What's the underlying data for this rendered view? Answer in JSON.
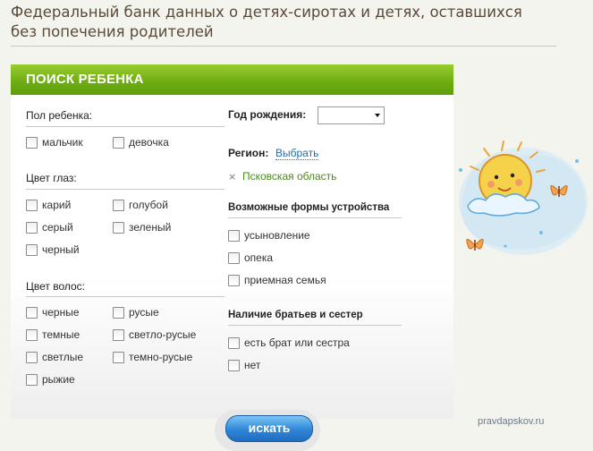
{
  "header": {
    "title": "Федеральный банк данных о детях-сиротах и детях, оставшихся без попечения родителей"
  },
  "card": {
    "title": "ПОИСК РЕБЕНКА",
    "gender": {
      "label": "Пол ребенка:",
      "options": [
        "мальчик",
        "девочка"
      ]
    },
    "eye_color": {
      "label": "Цвет глаз:",
      "options": [
        "карий",
        "голубой",
        "серый",
        "зеленый",
        "черный"
      ]
    },
    "hair_color": {
      "label": "Цвет волос:",
      "options": [
        "черные",
        "русые",
        "темные",
        "светло-русые",
        "светлые",
        "темно-русые",
        "рыжие"
      ]
    },
    "birth_year": {
      "label": "Год рождения:",
      "selected": ""
    },
    "region": {
      "label": "Регион:",
      "link": "Выбрать",
      "selected": "Псковская область",
      "remove_glyph": "×"
    },
    "placement": {
      "label": "Возможные формы устройства",
      "options": [
        "усыновление",
        "опека",
        "приемная семья"
      ]
    },
    "siblings": {
      "label": "Наличие братьев и сестер",
      "options": [
        "есть брат или сестра",
        "нет"
      ]
    },
    "search_button": "искать"
  },
  "watermark": "pravdapskov.ru",
  "colors": {
    "header_green": "#6fae12",
    "button_blue": "#2f86d6",
    "link_blue": "#1f6fb2",
    "region_green": "#4a8a1a"
  },
  "icons": [
    "checkbox-icon",
    "chevron-down-icon",
    "close-icon",
    "sun-illustration"
  ]
}
